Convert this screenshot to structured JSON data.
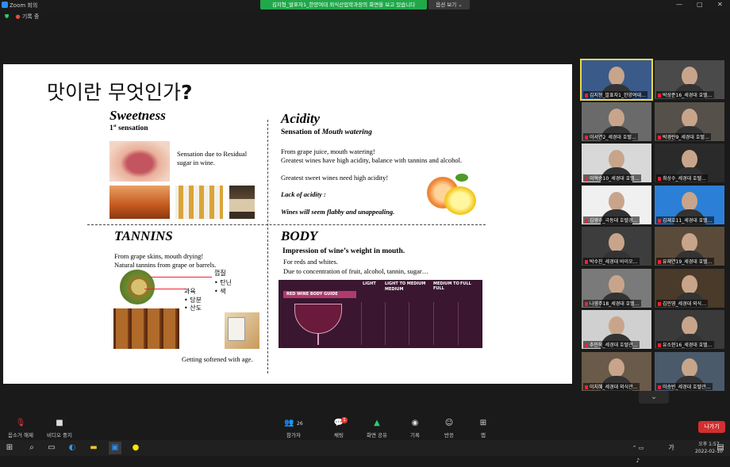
{
  "app": {
    "title": "Zoom 회의"
  },
  "window_controls": {
    "minimize": "—",
    "maximize": "▢",
    "close": "✕"
  },
  "share_banner": "김지형_발표자1_한양여대 외식산업학과장의 화면을 보고 있습니다",
  "view_options": "옵션 보기 ⌄",
  "recording": "기록 중",
  "slide": {
    "title": "맛이란 무엇인가",
    "title_mark": "?",
    "sweetness": {
      "heading": "Sweetness",
      "sub": "1st sensation",
      "sup": "st",
      "ord": "1",
      "rest": " sensation",
      "desc1": "Sensation due to Residual",
      "desc2": "sugar in wine."
    },
    "acidity": {
      "heading": "Acidity",
      "sub_prefix": "Sensation of ",
      "sub_italic": "Mouth watering",
      "l1": "From grape juice, mouth watering!",
      "l2": "Greatest wines have high acidity, balance with tannins and alcohol.",
      "l3": "Greatest sweet wines need high acidity!",
      "l4": "Lack of acidity :",
      "l5": "Wines will seem flabby and unappealing."
    },
    "tannins": {
      "heading": "TANNINS",
      "l1": "From grape skins, mouth drying!",
      "l2": "Natural tannins from grape or barrels.",
      "ko_peel": "껍질",
      "ko_list1": [
        "• 탄닌",
        "• 색"
      ],
      "ko_pulp": "과육",
      "ko_list2": [
        "• 당분",
        "• 산도"
      ],
      "footer": "Getting softened with age."
    },
    "body": {
      "heading": "BODY",
      "l1": "Impression of wine’s weight in mouth.",
      "l2": "For reds and whites.",
      "l3": "Due to concentration of fruit, alcohol, tannin, sugar…",
      "chart": {
        "title": "RED WINE BODY GUIDE",
        "cols": [
          "LIGHT",
          "LIGHT TO MEDIUM",
          "MEDIUM",
          "MEDIUM TO FULL",
          "FULL"
        ]
      }
    }
  },
  "gallery": [
    {
      "name": "김지형_발표자1_한양여대…",
      "active": true
    },
    {
      "name": "박상준16_세경대 호텔…"
    },
    {
      "name": "이서연2_세경대 호텔…"
    },
    {
      "name": "박경란9_세경대 호텔…"
    },
    {
      "name": "이혁승10_세경대 호텔…"
    },
    {
      "name": "최상수_세경대 호텔…"
    },
    {
      "name": "김영수_극동대 호텔경…"
    },
    {
      "name": "김재호11_세경대 호텔…"
    },
    {
      "name": "박수진_세경대 바이오…"
    },
    {
      "name": "유재연19_세경대 호텔…"
    },
    {
      "name": "나영주18_세경대 호텔…"
    },
    {
      "name": "김민영_세경대 외식…"
    },
    {
      "name": "추민욱_세경대 호텔관…"
    },
    {
      "name": "유소현16_세경대 호텔…"
    },
    {
      "name": "이지혜_세경대 외식관…"
    },
    {
      "name": "이승빈_세경대 호텔관…"
    }
  ],
  "toolbar": {
    "mute": "음소거 해제",
    "video": "비디오 중지",
    "participants": "참가자",
    "participants_count": "26",
    "chat": "채팅",
    "chat_badge": "1",
    "share": "화면 공유",
    "record": "기록",
    "reactions": "반응",
    "apps": "앱",
    "leave": "나가기"
  },
  "clock": {
    "time": "오후 1:57",
    "date": "2022-02-10"
  },
  "ime": "가"
}
